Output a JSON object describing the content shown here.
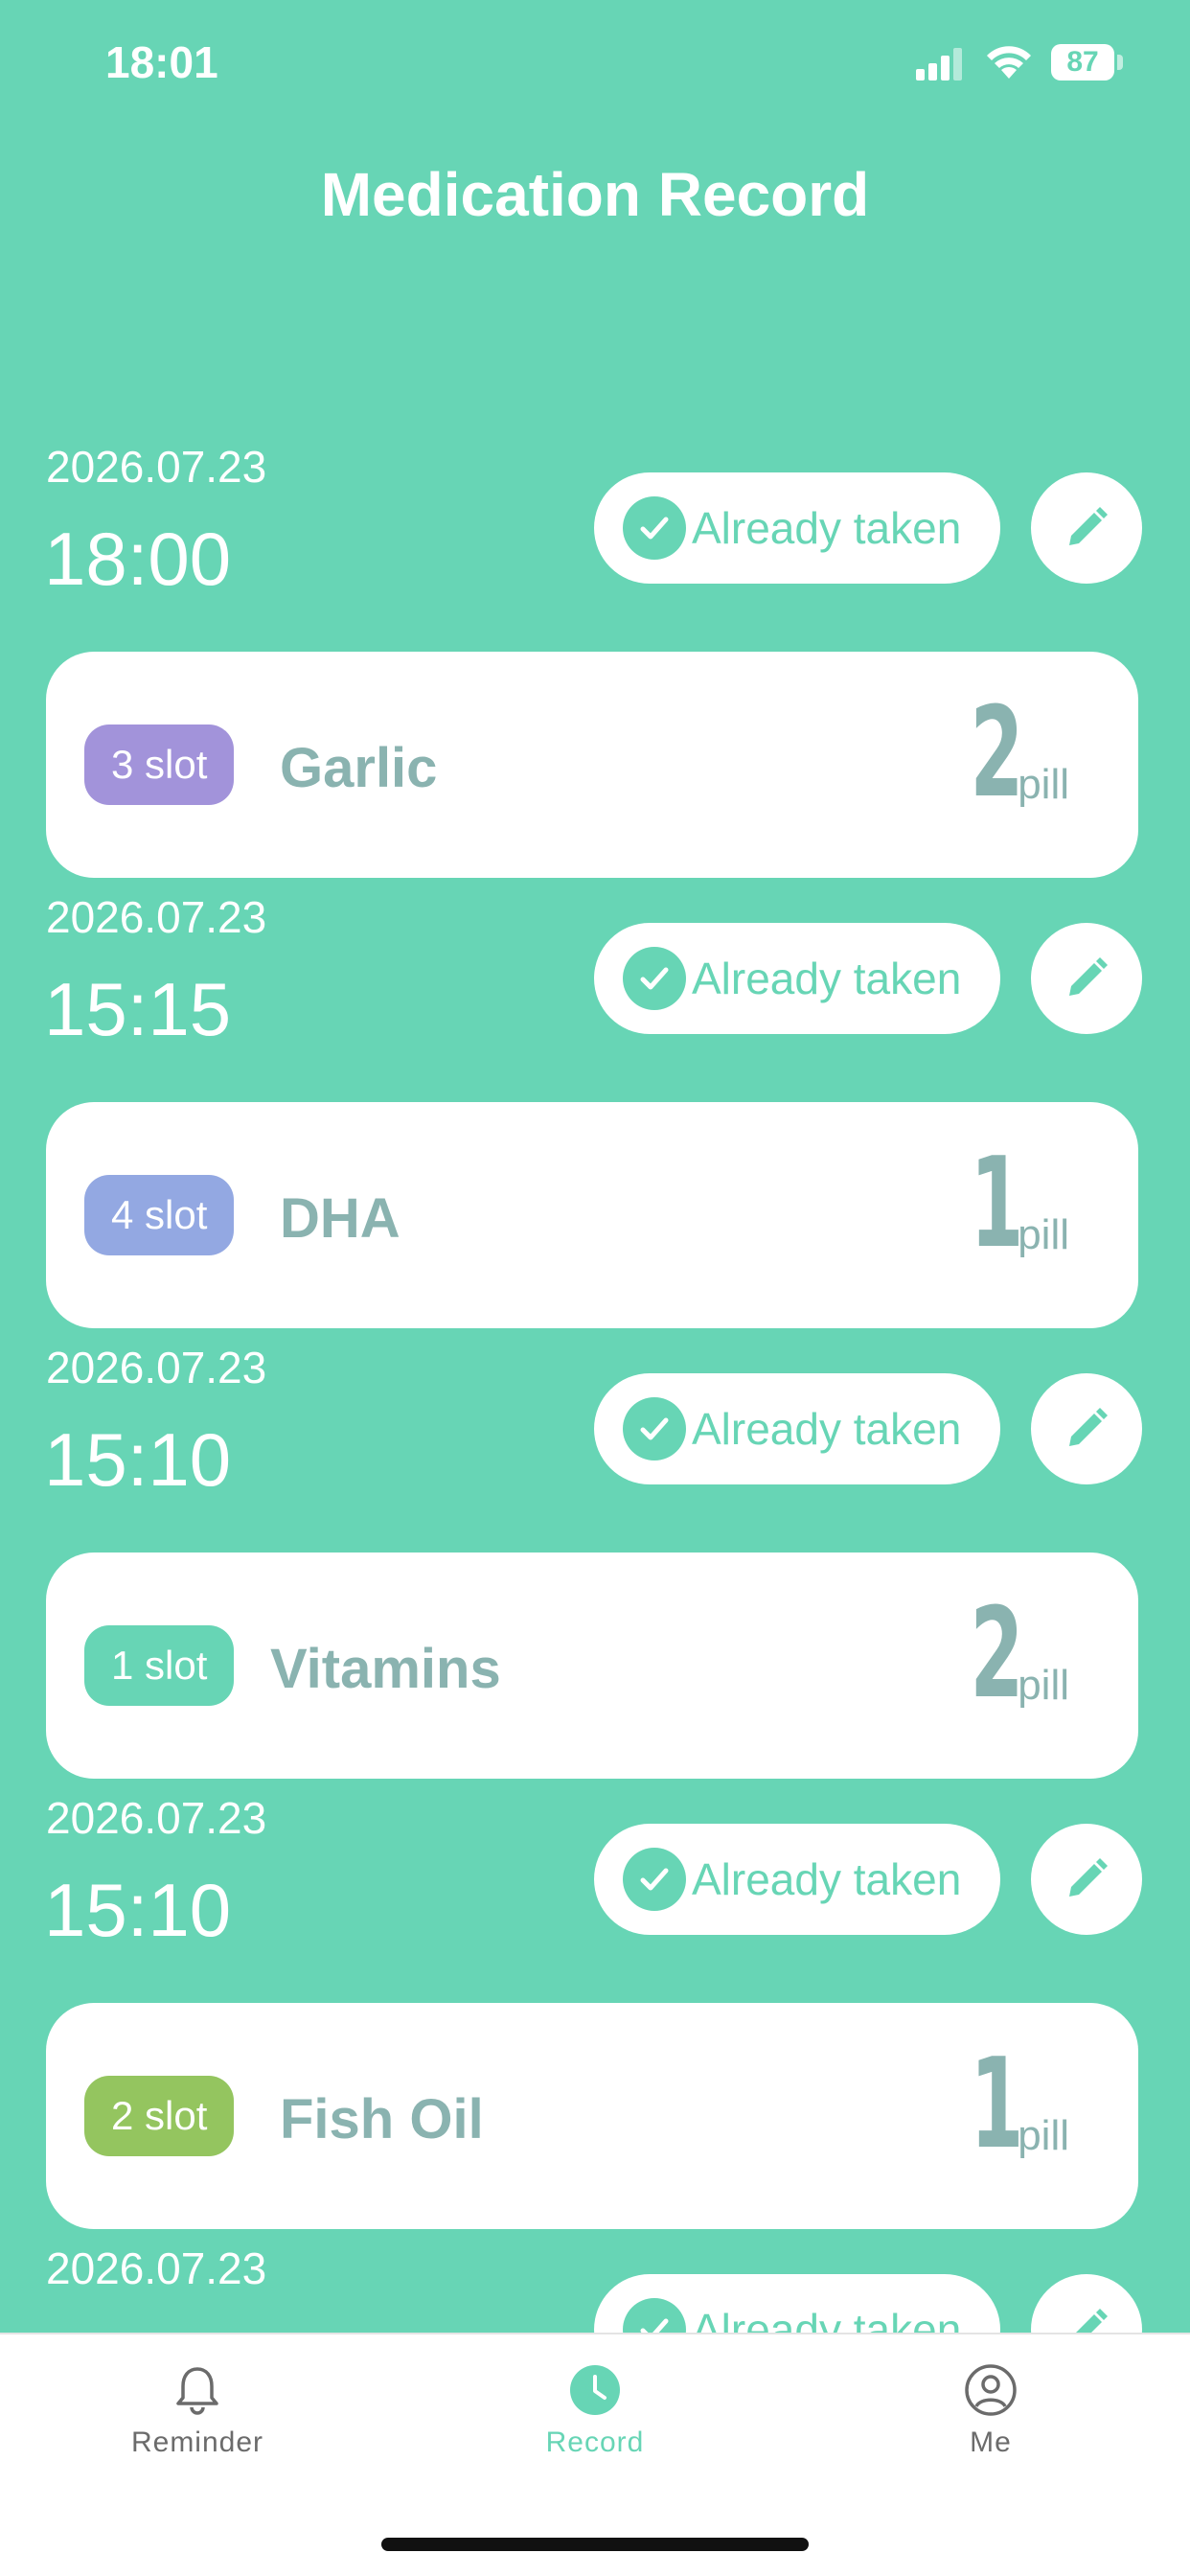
{
  "status_bar": {
    "time": "18:01",
    "battery": "87"
  },
  "title": "Medication Record",
  "colors": {
    "accent": "#67D5B5",
    "text_muted": "#8AB3B0"
  },
  "records": [
    {
      "date": "2026.07.23",
      "time": "18:00",
      "status": "Already taken",
      "slot": "3 slot",
      "slot_color": "#A293DA",
      "medicine": "Garlic",
      "count": "2",
      "unit": "pill"
    },
    {
      "date": "2026.07.23",
      "time": "15:15",
      "status": "Already taken",
      "slot": "4 slot",
      "slot_color": "#93A8E2",
      "medicine": "DHA",
      "count": "1",
      "unit": "pill"
    },
    {
      "date": "2026.07.23",
      "time": "15:10",
      "status": "Already taken",
      "slot": "1 slot",
      "slot_color": "#67D5B5",
      "medicine": "Vitamins",
      "count": "2",
      "unit": "pill"
    },
    {
      "date": "2026.07.23",
      "time": "15:10",
      "status": "Already taken",
      "slot": "2 slot",
      "slot_color": "#94C55F",
      "medicine": "Fish Oil",
      "count": "1",
      "unit": "pill"
    },
    {
      "date": "2026.07.23",
      "time": "",
      "status": "Already taken"
    }
  ],
  "tabs": [
    {
      "label": "Reminder",
      "icon": "bell-icon",
      "active": false
    },
    {
      "label": "Record",
      "icon": "clock-icon",
      "active": true
    },
    {
      "label": "Me",
      "icon": "user-icon",
      "active": false
    }
  ]
}
